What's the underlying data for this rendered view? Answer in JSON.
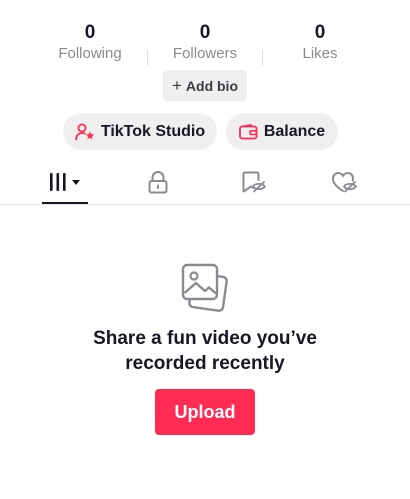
{
  "stats": {
    "following": {
      "count": "0",
      "label": "Following"
    },
    "followers": {
      "count": "0",
      "label": "Followers"
    },
    "likes": {
      "count": "0",
      "label": "Likes"
    }
  },
  "add_bio": {
    "icon": "plus-icon",
    "label": "Add bio"
  },
  "pills": {
    "studio": {
      "icon": "creator-star-icon",
      "label": "TikTok Studio",
      "icon_color": "#fe2c55"
    },
    "balance": {
      "icon": "wallet-icon",
      "label": "Balance",
      "icon_color": "#fe2c55"
    }
  },
  "tabs": [
    {
      "icon": "videos-grid-icon",
      "selected": true,
      "has_dropdown": true
    },
    {
      "icon": "lock-icon",
      "selected": false
    },
    {
      "icon": "bookmark-hidden-icon",
      "selected": false
    },
    {
      "icon": "heart-hidden-icon",
      "selected": false
    }
  ],
  "empty_state": {
    "icon": "photos-icon",
    "title": "Share a fun video you’ve recorded recently",
    "button_label": "Upload"
  },
  "colors": {
    "accent": "#fe2c55",
    "text": "#161823",
    "muted": "#8a8b91",
    "chip_bg": "#efeff0"
  }
}
